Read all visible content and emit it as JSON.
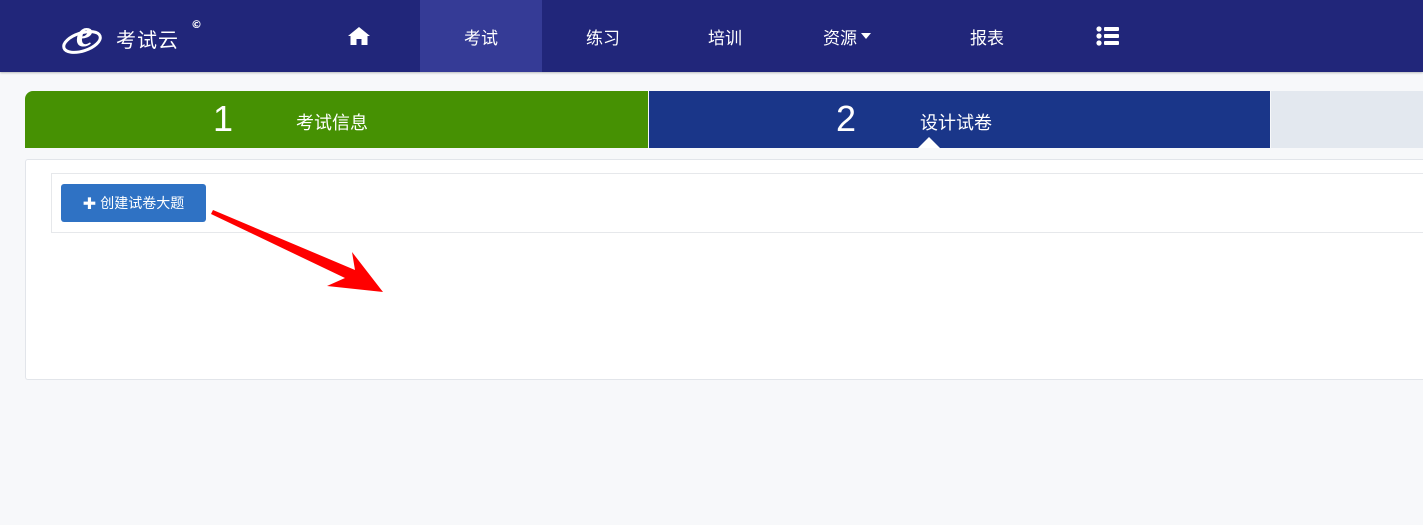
{
  "header": {
    "logo_text": "考试云",
    "logo_copyright": "©",
    "nav": [
      {
        "icon": "home-icon"
      },
      {
        "label": "考试",
        "active": true
      },
      {
        "label": "练习"
      },
      {
        "label": "培训"
      },
      {
        "label": "资源",
        "has_dropdown": true
      },
      {
        "label": "报表"
      },
      {
        "icon": "list-icon"
      }
    ]
  },
  "steps": [
    {
      "number": "1",
      "label": "考试信息",
      "state": "done"
    },
    {
      "number": "2",
      "label": "设计试卷",
      "state": "current"
    },
    {
      "number": "",
      "label": "",
      "state": "pending"
    }
  ],
  "main": {
    "create_button_label": "创建试卷大题",
    "create_button_icon": "plus-icon"
  },
  "colors": {
    "navbar": "#21267a",
    "nav_active": "#353b96",
    "step_done": "#469103",
    "step_current": "#1a3689",
    "step_pending": "#e3e8ef",
    "primary_button": "#2f72c4",
    "annotation_arrow": "#ff0000"
  }
}
